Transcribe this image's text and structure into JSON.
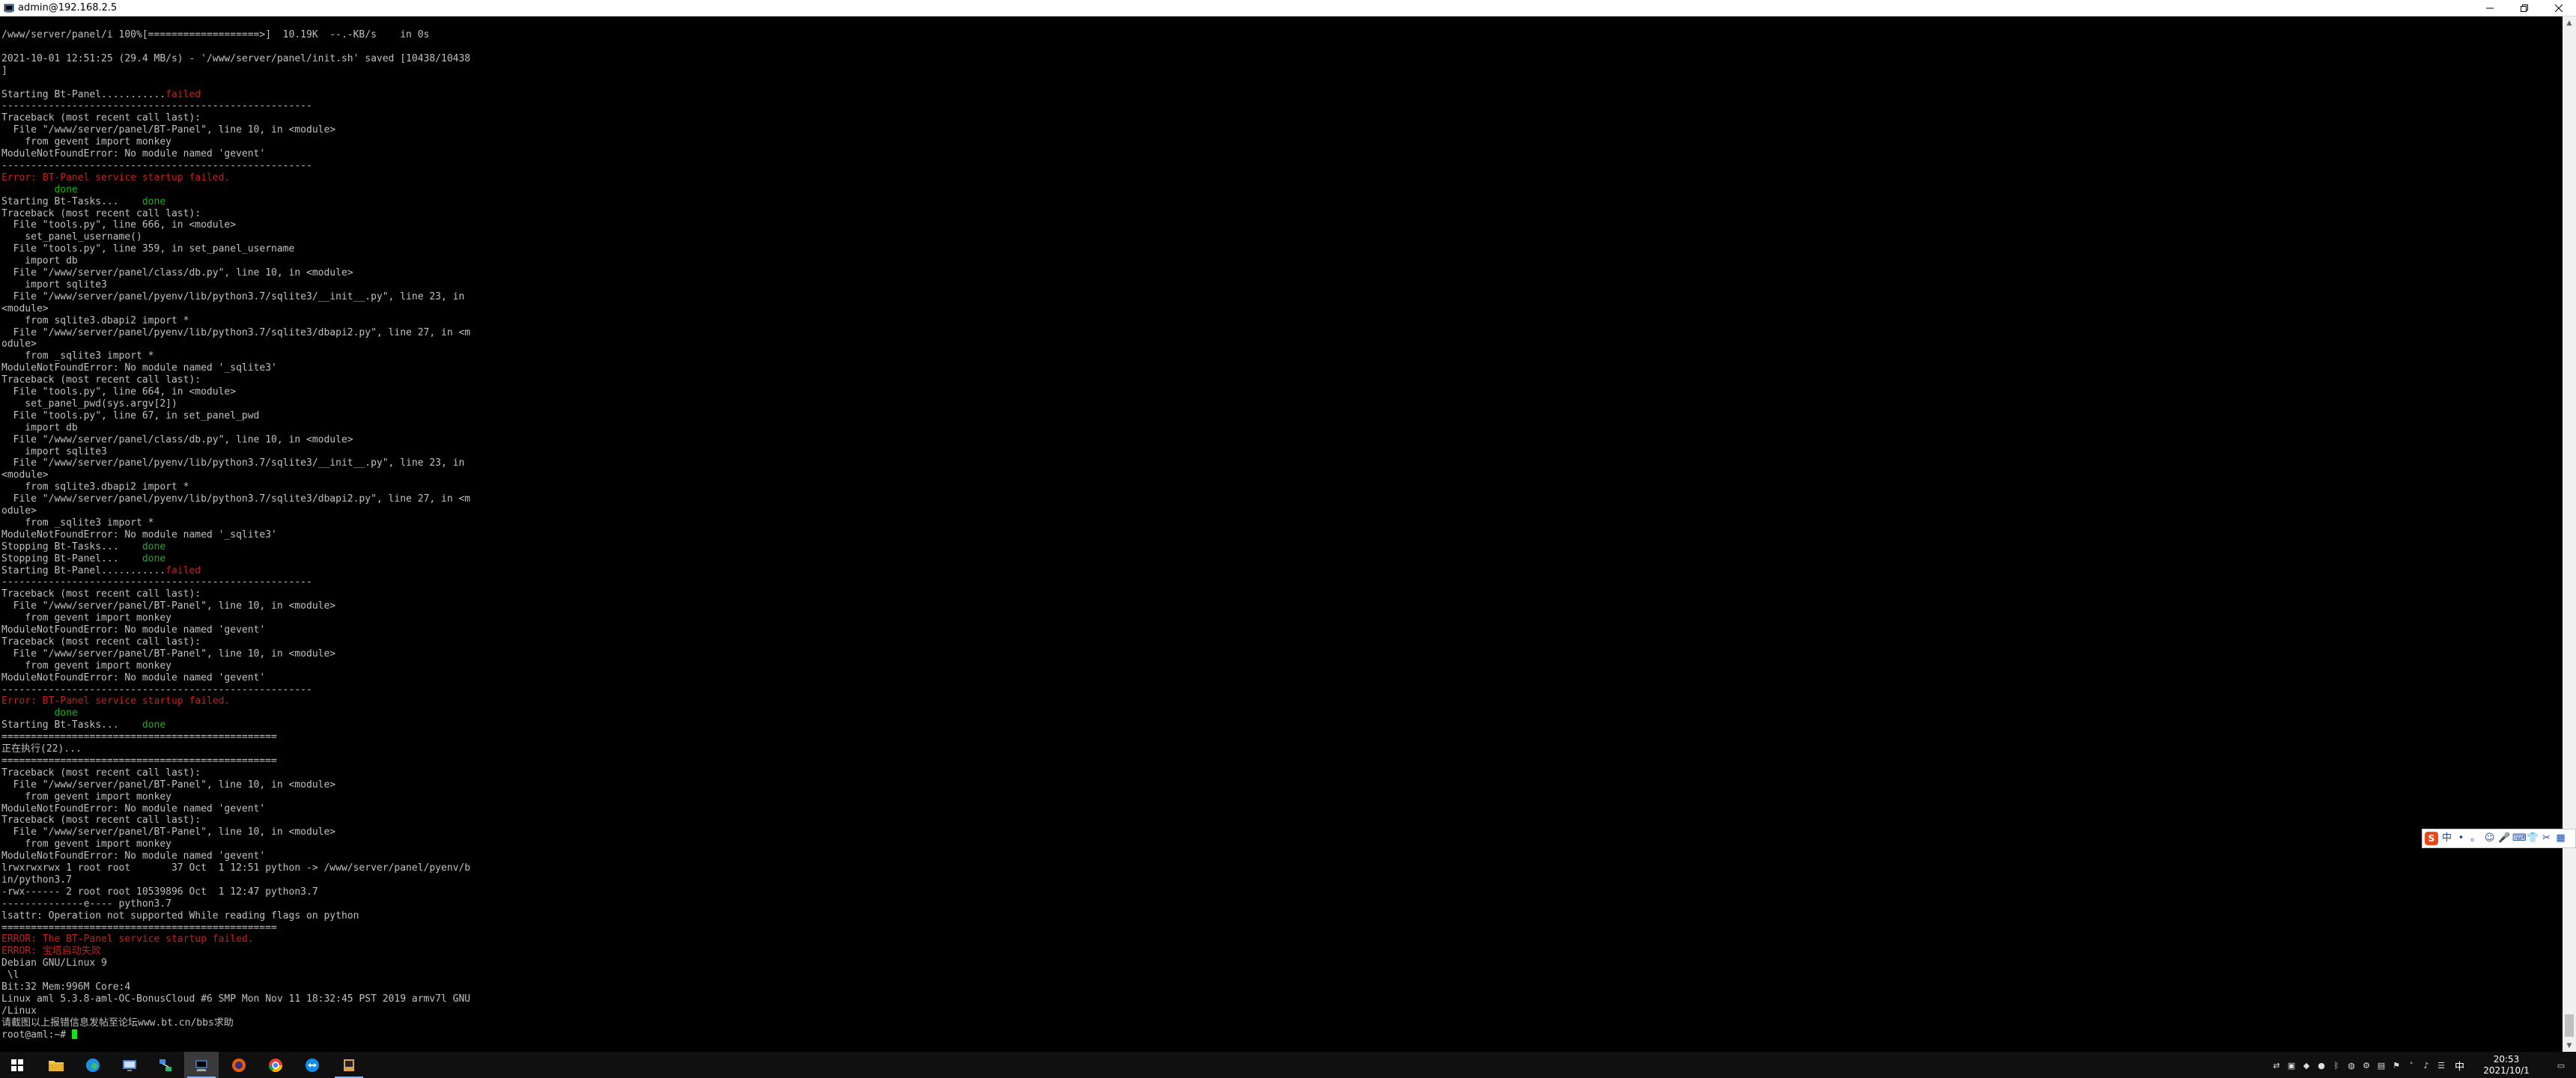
{
  "window": {
    "title": "admin@192.168.2.5"
  },
  "terminal": {
    "lines": [
      {
        "text": "/www/server/panel/i 100%[===================>]  10.19K  --.-KB/s    in 0s"
      },
      {
        "text": ""
      },
      {
        "text": "2021-10-01 12:51:25 (29.4 MB/s) - '/www/server/panel/init.sh' saved [10438/10438"
      },
      {
        "text": "]"
      },
      {
        "text": ""
      },
      {
        "text": "Starting Bt-Panel...........",
        "suffix": "failed",
        "suffix_style": "fail"
      },
      {
        "text": "-----------------------------------------------------"
      },
      {
        "text": "Traceback (most recent call last):"
      },
      {
        "text": "  File \"/www/server/panel/BT-Panel\", line 10, in <module>"
      },
      {
        "text": "    from gevent import monkey"
      },
      {
        "text": "ModuleNotFoundError: No module named 'gevent'"
      },
      {
        "text": "-----------------------------------------------------"
      },
      {
        "text": "Error: BT-Panel service startup failed.",
        "style": "red"
      },
      {
        "text": "         ",
        "suffix": "done",
        "suffix_style": "ok"
      },
      {
        "text": "Starting Bt-Tasks...    ",
        "suffix": "done",
        "suffix_style": "ok"
      },
      {
        "text": "Traceback (most recent call last):"
      },
      {
        "text": "  File \"tools.py\", line 666, in <module>"
      },
      {
        "text": "    set_panel_username()"
      },
      {
        "text": "  File \"tools.py\", line 359, in set_panel_username"
      },
      {
        "text": "    import db"
      },
      {
        "text": "  File \"/www/server/panel/class/db.py\", line 10, in <module>"
      },
      {
        "text": "    import sqlite3"
      },
      {
        "text": "  File \"/www/server/panel/pyenv/lib/python3.7/sqlite3/__init__.py\", line 23, in"
      },
      {
        "text": "<module>"
      },
      {
        "text": "    from sqlite3.dbapi2 import *"
      },
      {
        "text": "  File \"/www/server/panel/pyenv/lib/python3.7/sqlite3/dbapi2.py\", line 27, in <m"
      },
      {
        "text": "odule>"
      },
      {
        "text": "    from _sqlite3 import *"
      },
      {
        "text": "ModuleNotFoundError: No module named '_sqlite3'"
      },
      {
        "text": "Traceback (most recent call last):"
      },
      {
        "text": "  File \"tools.py\", line 664, in <module>"
      },
      {
        "text": "    set_panel_pwd(sys.argv[2])"
      },
      {
        "text": "  File \"tools.py\", line 67, in set_panel_pwd"
      },
      {
        "text": "    import db"
      },
      {
        "text": "  File \"/www/server/panel/class/db.py\", line 10, in <module>"
      },
      {
        "text": "    import sqlite3"
      },
      {
        "text": "  File \"/www/server/panel/pyenv/lib/python3.7/sqlite3/__init__.py\", line 23, in"
      },
      {
        "text": "<module>"
      },
      {
        "text": "    from sqlite3.dbapi2 import *"
      },
      {
        "text": "  File \"/www/server/panel/pyenv/lib/python3.7/sqlite3/dbapi2.py\", line 27, in <m"
      },
      {
        "text": "odule>"
      },
      {
        "text": "    from _sqlite3 import *"
      },
      {
        "text": "ModuleNotFoundError: No module named '_sqlite3'"
      },
      {
        "text": "Stopping Bt-Tasks...    ",
        "suffix": "done",
        "suffix_style": "ok"
      },
      {
        "text": "Stopping Bt-Panel...    ",
        "suffix": "done",
        "suffix_style": "ok"
      },
      {
        "text": "Starting Bt-Panel...........",
        "suffix": "failed",
        "suffix_style": "fail"
      },
      {
        "text": "-----------------------------------------------------"
      },
      {
        "text": "Traceback (most recent call last):"
      },
      {
        "text": "  File \"/www/server/panel/BT-Panel\", line 10, in <module>"
      },
      {
        "text": "    from gevent import monkey"
      },
      {
        "text": "ModuleNotFoundError: No module named 'gevent'"
      },
      {
        "text": "Traceback (most recent call last):"
      },
      {
        "text": "  File \"/www/server/panel/BT-Panel\", line 10, in <module>"
      },
      {
        "text": "    from gevent import monkey"
      },
      {
        "text": "ModuleNotFoundError: No module named 'gevent'"
      },
      {
        "text": "-----------------------------------------------------"
      },
      {
        "text": "Error: BT-Panel service startup failed.",
        "style": "red"
      },
      {
        "text": "         ",
        "suffix": "done",
        "suffix_style": "ok"
      },
      {
        "text": "Starting Bt-Tasks...    ",
        "suffix": "done",
        "suffix_style": "ok"
      },
      {
        "text": "===============================================",
        "style": "dim"
      },
      {
        "text": "正在执行(22)..."
      },
      {
        "text": "===============================================",
        "style": "dim"
      },
      {
        "text": "Traceback (most recent call last):"
      },
      {
        "text": "  File \"/www/server/panel/BT-Panel\", line 10, in <module>"
      },
      {
        "text": "    from gevent import monkey"
      },
      {
        "text": "ModuleNotFoundError: No module named 'gevent'"
      },
      {
        "text": "Traceback (most recent call last):"
      },
      {
        "text": "  File \"/www/server/panel/BT-Panel\", line 10, in <module>"
      },
      {
        "text": "    from gevent import monkey"
      },
      {
        "text": "ModuleNotFoundError: No module named 'gevent'"
      },
      {
        "text": "lrwxrwxrwx 1 root root       37 Oct  1 12:51 python -> /www/server/panel/pyenv/b"
      },
      {
        "text": "in/python3.7"
      },
      {
        "text": "-rwx------ 2 root root 10539896 Oct  1 12:47 python3.7"
      },
      {
        "text": "--------------e---- python3.7"
      },
      {
        "text": "lsattr: Operation not supported While reading flags on python"
      },
      {
        "text": "===============================================",
        "style": "dim"
      },
      {
        "text": "ERROR: The BT-Panel service startup failed.",
        "style": "red"
      },
      {
        "text": "ERROR: 宝塔启动失败",
        "style": "red"
      },
      {
        "text": "Debian GNU/Linux 9"
      },
      {
        "text": " \\l"
      },
      {
        "text": "Bit:32 Mem:996M Core:4"
      },
      {
        "text": "Linux aml 5.3.8-aml-OC-BonusCloud #6 SMP Mon Nov 11 18:32:45 PST 2019 armv7l GNU"
      },
      {
        "text": "/Linux"
      },
      {
        "text": "请截图以上报错信息发帖至论坛www.bt.cn/bbs求助"
      },
      {
        "text": "root@aml:~# ",
        "cursor": true
      }
    ]
  },
  "ime": {
    "logo": "S",
    "items": [
      "中",
      "•",
      "。",
      "☺",
      "🎤",
      "⌨",
      "👕",
      "✂",
      "▦"
    ]
  },
  "taskbar": {
    "apps": [
      {
        "name": "start-button",
        "icon": "windows-icon"
      },
      {
        "name": "taskbar-file-explorer",
        "icon": "folder-icon"
      },
      {
        "name": "taskbar-edge",
        "icon": "edge-icon"
      },
      {
        "name": "taskbar-remote-app",
        "icon": "remote-icon"
      },
      {
        "name": "taskbar-network-tool",
        "icon": "network-icon"
      },
      {
        "name": "taskbar-putty",
        "icon": "putty-icon"
      },
      {
        "name": "taskbar-firefox",
        "icon": "firefox-icon"
      },
      {
        "name": "taskbar-chrome",
        "icon": "chrome-icon"
      },
      {
        "name": "taskbar-teamviewer",
        "icon": "teamviewer-icon"
      },
      {
        "name": "taskbar-terminal",
        "icon": "terminal-icon"
      }
    ],
    "tray": {
      "lang": "中",
      "time": "20:53",
      "date": "2021/10/1"
    }
  },
  "colors": {
    "terminal_bg": "#000000",
    "terminal_fg": "#c0c0c0",
    "ok": "#16b416",
    "fail": "#c81e1e",
    "taskbar_bg": "#101010"
  }
}
